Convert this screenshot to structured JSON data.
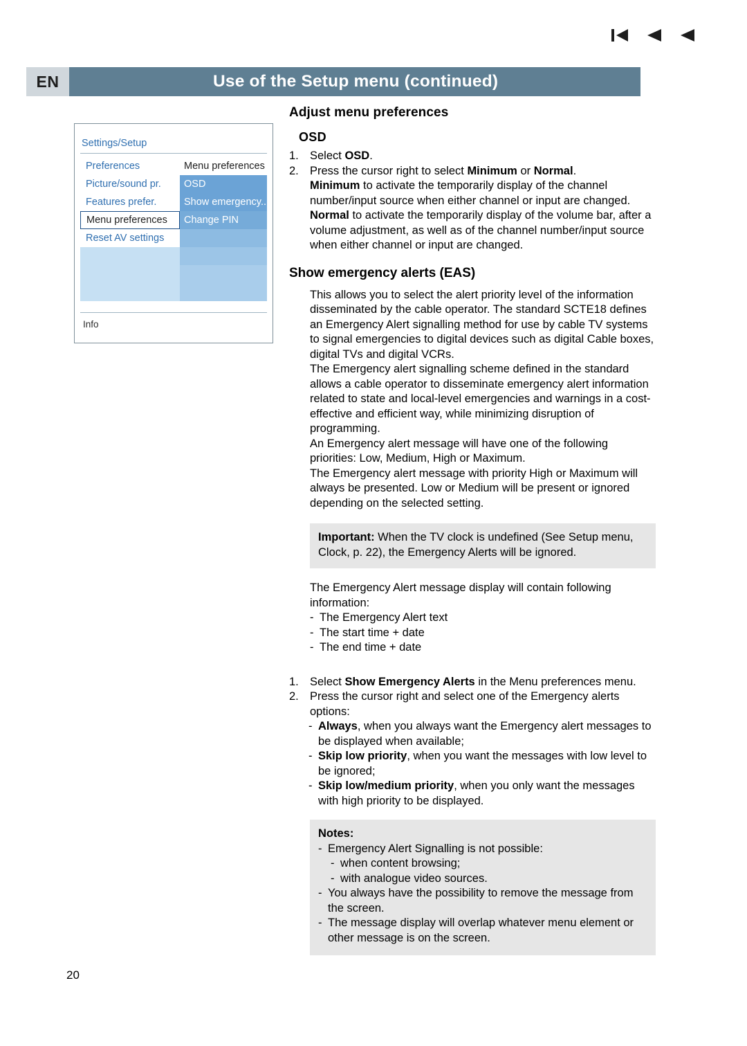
{
  "nav": {
    "first_icon": "skip-back-icon",
    "prev_icon": "triangle-left-icon",
    "back_icon": "triangle-left-icon-2"
  },
  "header": {
    "language": "EN",
    "title": "Use of the Setup menu  (continued)"
  },
  "osd": {
    "title": "Settings/Setup",
    "left_items": [
      {
        "label": "Preferences",
        "selected": false
      },
      {
        "label": "Picture/sound pr.",
        "selected": false
      },
      {
        "label": "Features prefer.",
        "selected": false
      },
      {
        "label": "Menu preferences",
        "selected": true
      },
      {
        "label": "Reset AV settings",
        "selected": false
      }
    ],
    "right_header": "Menu preferences",
    "right_items": [
      "OSD",
      "Show emergency..",
      "Change PIN"
    ],
    "info": "Info"
  },
  "content": {
    "section1_title": "Adjust menu preferences",
    "osd_heading": "OSD",
    "steps": [
      {
        "num": "1.",
        "text_plain": "Select ",
        "bold": "OSD",
        "tail": "."
      },
      {
        "num": "2.",
        "text_plain": "Press the cursor right to select ",
        "bold": "Minimum",
        "mid": " or ",
        "bold2": "Normal",
        "tail": "."
      }
    ],
    "minimum_para_bold": "Minimum",
    "minimum_para": " to activate the temporarily display of the channel number/input source when either channel or input are changed.",
    "normal_para_bold": "Normal",
    "normal_para": " to activate the temporarily display of the volume bar, after a volume adjustment, as well as of the channel number/input source when either channel or input are changed.",
    "section2_title": "Show emergency alerts (EAS)",
    "eas_paragraphs": [
      "This allows you to select the alert priority level of the information disseminated by the cable operator. The standard SCTE18 defines an Emergency Alert signalling method for use by cable TV systems to signal emergencies to digital devices such as digital Cable boxes, digital TVs and digital VCRs.",
      "The Emergency alert signalling scheme defined in the standard allows a cable operator to disseminate emergency alert information related to state and local-level emergencies and warnings in a cost-effective and efficient way, while minimizing disruption of programming.",
      "An Emergency alert message will have one of the following priorities: Low, Medium, High or Maximum.",
      "The Emergency alert message with priority High or Maximum will always be presented. Low or Medium will be present or ignored depending on the selected setting."
    ],
    "important_bold": "Important:",
    "important_text": " When the TV clock is undefined (See Setup menu, Clock, p. 22), the Emergency Alerts will be ignored.",
    "display_intro": "The Emergency Alert message display will contain following information:",
    "display_items": [
      "The Emergency Alert text",
      "The start time + date",
      "The end time + date"
    ],
    "final_steps": [
      {
        "num": "1.",
        "pre": "Select ",
        "bold": "Show Emergency Alerts",
        "post": " in the Menu preferences menu."
      },
      {
        "num": "2.",
        "pre": "Press the cursor right and select one of the Emergency alerts options:",
        "bold": "",
        "post": ""
      }
    ],
    "options": [
      {
        "bold": "Always",
        "text": ", when you always want the Emergency alert messages to be displayed when available;"
      },
      {
        "bold": "Skip low priority",
        "text": ", when you want the messages with low level to be ignored;"
      },
      {
        "bold": "Skip low/medium priority",
        "text": ", when you only want the messages with high priority to be displayed."
      }
    ],
    "notes_title": "Notes:",
    "notes": [
      {
        "text": "Emergency Alert Signalling is not possible:",
        "sub": [
          "when content browsing;",
          "with analogue video sources."
        ]
      },
      {
        "text": "You always have the possibility to remove the message from the screen.",
        "sub": []
      },
      {
        "text": "The message display will overlap whatever menu element or other message is on the screen.",
        "sub": []
      }
    ]
  },
  "page_number": "20",
  "colors": {
    "header_band": "#5f7f93",
    "lang_chip": "#d0d7dc",
    "osd_blue_text": "#2f6fb0",
    "osd_highlight": "#6ba3d6",
    "callout_bg": "#e6e6e6"
  }
}
